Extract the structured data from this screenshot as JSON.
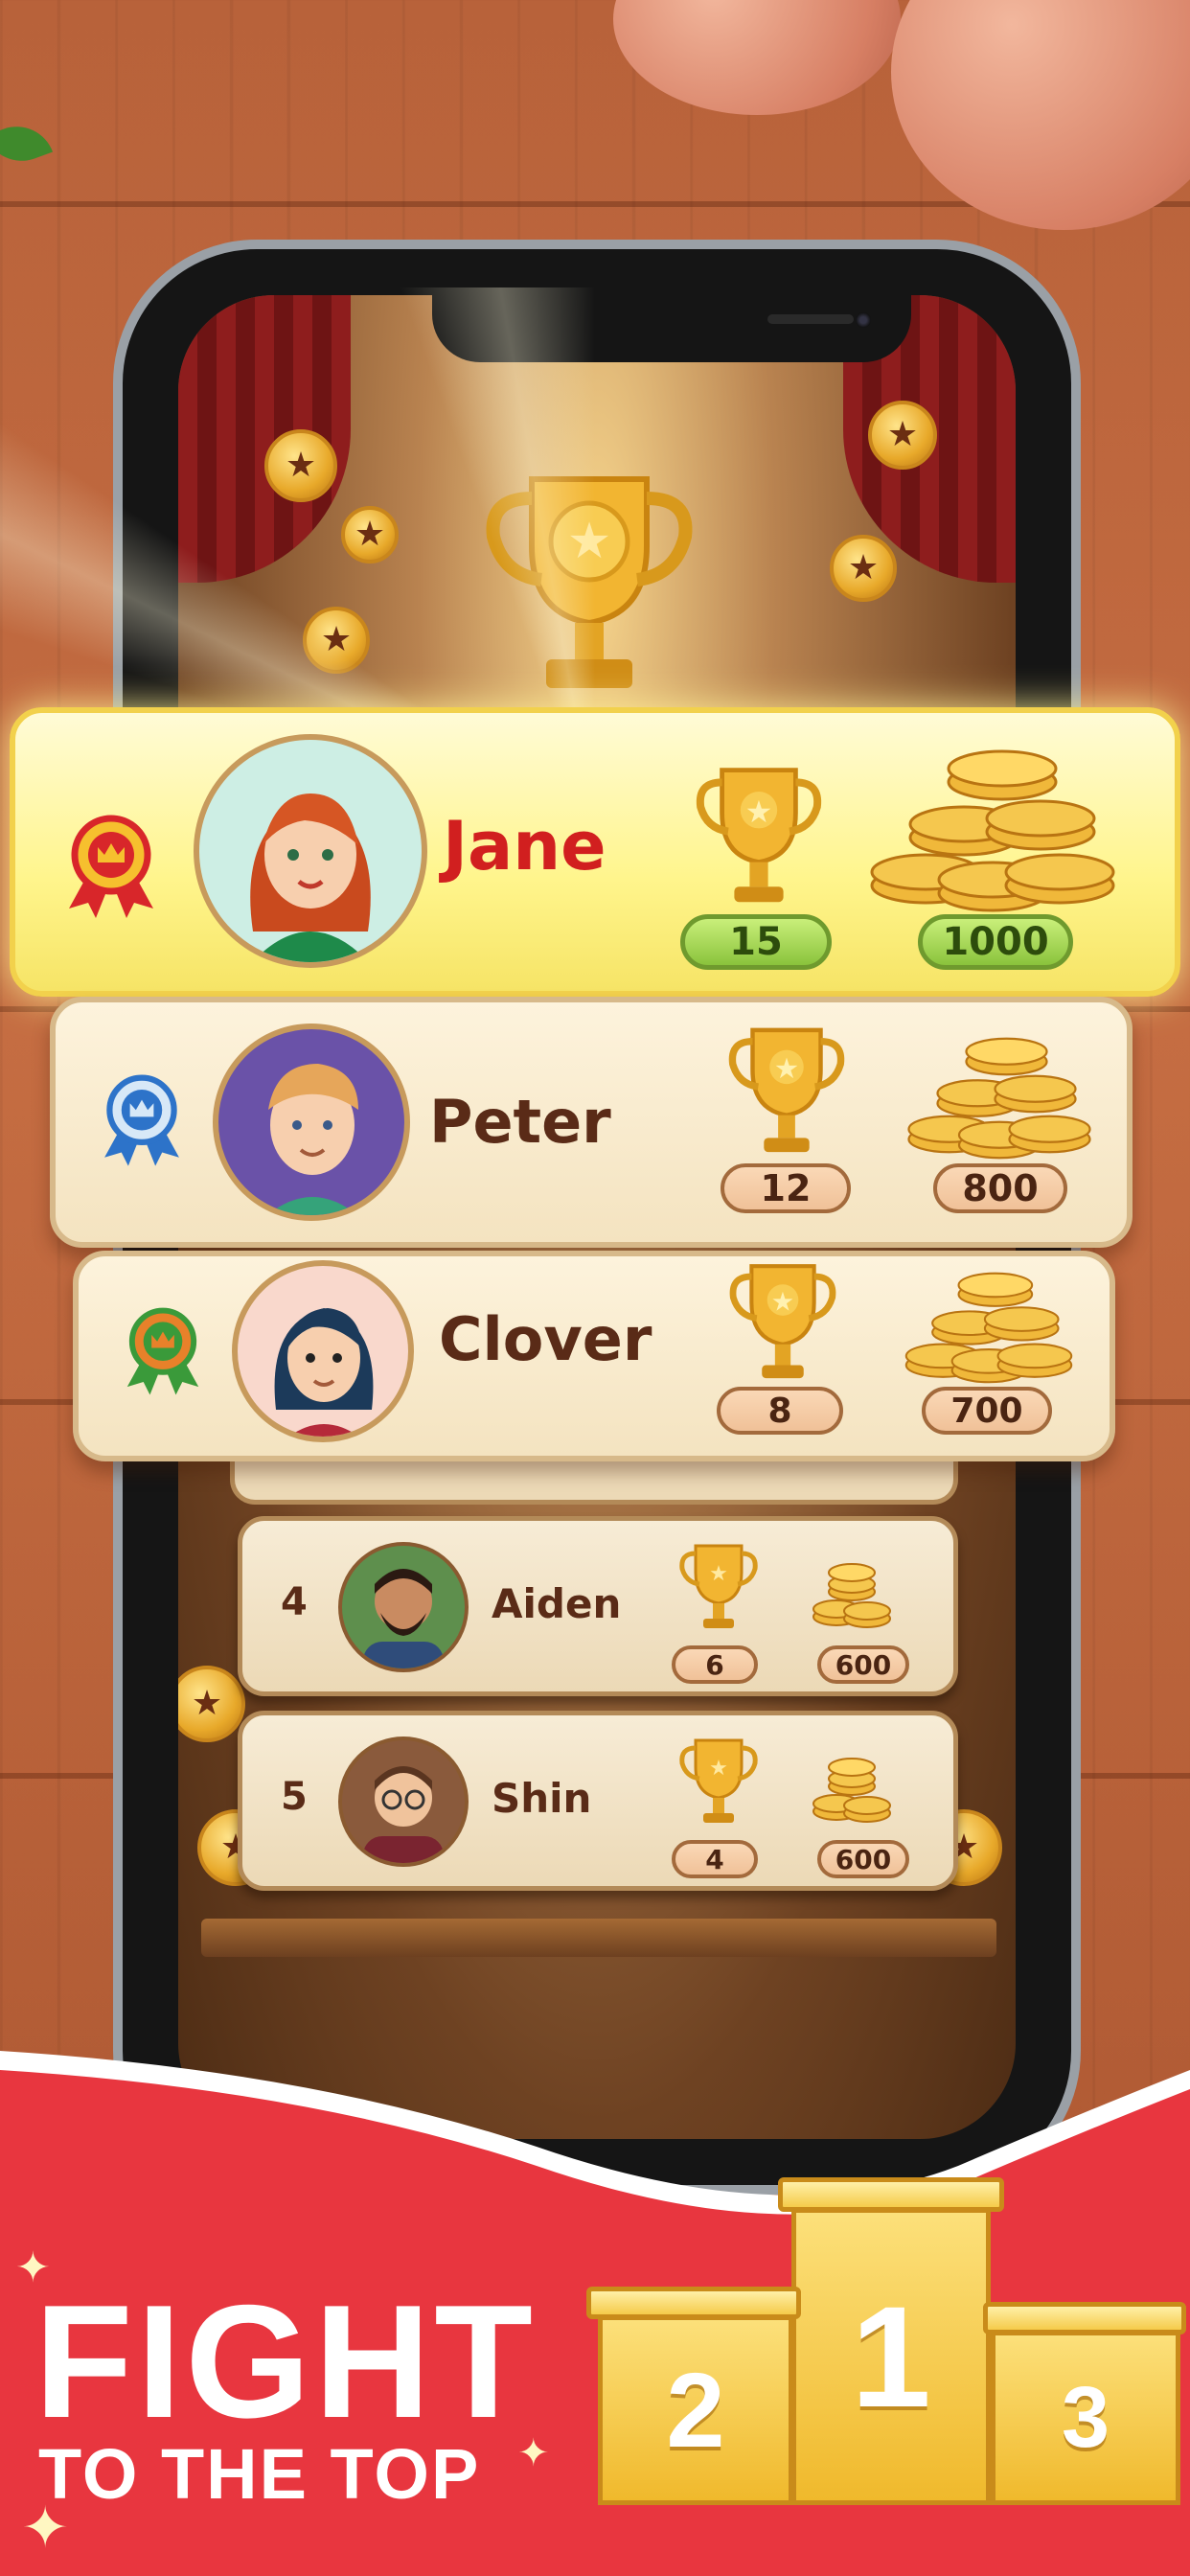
{
  "leaderboard": {
    "top": [
      {
        "rank_medal": "gold-crown-ribbon",
        "name": "Jane",
        "trophies": "15",
        "coins": "1000"
      },
      {
        "rank_medal": "blue-crown-ribbon",
        "name": "Peter",
        "trophies": "12",
        "coins": "800"
      },
      {
        "rank_medal": "green-crown-ribbon",
        "name": "Clover",
        "trophies": "8",
        "coins": "700"
      }
    ],
    "rows": [
      {
        "rank": "4",
        "name": "Aiden",
        "trophies": "6",
        "coins": "600"
      },
      {
        "rank": "5",
        "name": "Shin",
        "trophies": "4",
        "coins": "600"
      }
    ]
  },
  "banner": {
    "headline": "FIGHT",
    "subline": "TO THE TOP",
    "podium": {
      "first": "1",
      "second": "2",
      "third": "3"
    }
  },
  "colors": {
    "banner_red": "#e8363f",
    "gold_card": "#fff58c",
    "cream_card": "#fdf3dc",
    "name_highlight": "#d11f1f",
    "name_default": "#5a2b17"
  }
}
